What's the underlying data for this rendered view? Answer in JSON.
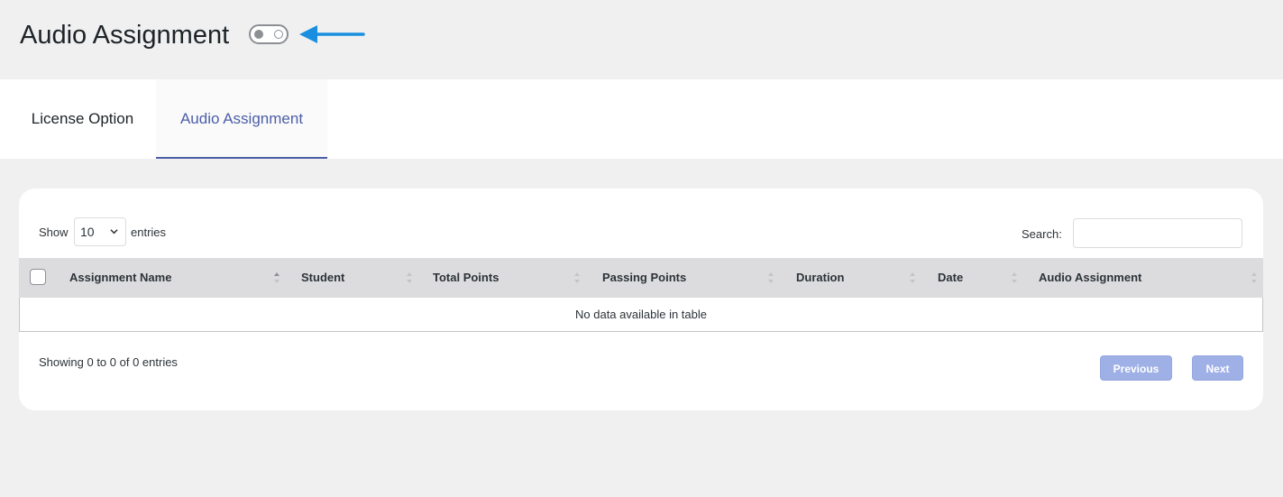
{
  "header": {
    "title": "Audio Assignment",
    "toggle_icon": "toggle-off-icon",
    "arrow_icon": "arrow-left-icon",
    "arrow_color": "#1a8fe0"
  },
  "tabs": [
    {
      "label": "License Option",
      "active": false
    },
    {
      "label": "Audio Assignment",
      "active": true
    }
  ],
  "table_controls": {
    "show_label": "Show",
    "entries_value": "10",
    "entries_label": "entries",
    "search_label": "Search:",
    "search_value": ""
  },
  "table": {
    "columns": [
      "Assignment Name",
      "Student",
      "Total Points",
      "Passing Points",
      "Duration",
      "Date",
      "Audio Assignment"
    ],
    "empty_message": "No data available in table"
  },
  "footer": {
    "info": "Showing 0 to 0 of 0 entries",
    "previous_label": "Previous",
    "next_label": "Next"
  },
  "colors": {
    "accent": "#4b5eaa",
    "button_disabled": "#9fb0e6"
  }
}
